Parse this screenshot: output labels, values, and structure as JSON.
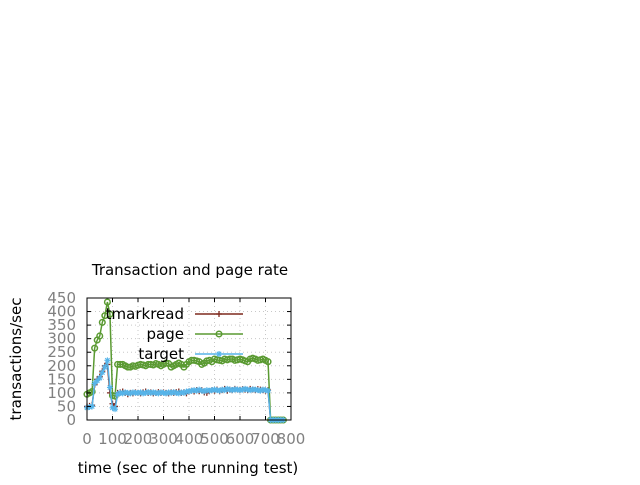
{
  "chart_data": {
    "type": "line",
    "title": "Transaction and page rate",
    "xlabel": "time (sec of the running test)",
    "ylabel": "transactions/sec",
    "xlim": [
      0,
      800
    ],
    "ylim": [
      0,
      450
    ],
    "xticks": [
      0,
      100,
      200,
      300,
      400,
      500,
      600,
      700,
      800
    ],
    "yticks": [
      0,
      50,
      100,
      150,
      200,
      250,
      300,
      350,
      400,
      450
    ],
    "grid": true,
    "legend_position": "top-right",
    "series": [
      {
        "name": "tmarkread",
        "color": "#7f2a1f",
        "marker": "plus",
        "x": [
          0,
          10,
          20,
          30,
          40,
          50,
          60,
          70,
          80,
          90,
          100,
          110,
          120,
          130,
          140,
          150,
          160,
          170,
          180,
          190,
          200,
          210,
          220,
          230,
          240,
          250,
          260,
          270,
          280,
          290,
          300,
          310,
          320,
          330,
          340,
          350,
          360,
          370,
          380,
          390,
          400,
          410,
          420,
          430,
          440,
          450,
          460,
          470,
          480,
          490,
          500,
          510,
          520,
          530,
          540,
          550,
          560,
          570,
          580,
          590,
          600,
          610,
          620,
          630,
          640,
          650,
          660,
          670,
          680,
          690,
          700,
          710,
          720,
          730,
          740,
          750,
          760,
          770
        ],
        "y": [
          50,
          52,
          55,
          130,
          150,
          160,
          180,
          200,
          205,
          100,
          60,
          50,
          100,
          102,
          105,
          100,
          95,
          100,
          98,
          102,
          100,
          98,
          102,
          105,
          100,
          102,
          98,
          100,
          103,
          100,
          102,
          100,
          98,
          102,
          100,
          103,
          105,
          100,
          102,
          98,
          105,
          108,
          105,
          110,
          106,
          110,
          102,
          100,
          106,
          110,
          108,
          112,
          106,
          110,
          115,
          108,
          112,
          110,
          115,
          112,
          110,
          114,
          112,
          110,
          115,
          112,
          110,
          114,
          112,
          110,
          108,
          110,
          0,
          0,
          0,
          0,
          0,
          0
        ]
      },
      {
        "name": "page",
        "color": "#5a9a32",
        "marker": "circle",
        "x": [
          0,
          10,
          20,
          30,
          40,
          50,
          60,
          70,
          80,
          90,
          100,
          110,
          120,
          130,
          140,
          150,
          160,
          170,
          180,
          190,
          200,
          210,
          220,
          230,
          240,
          250,
          260,
          270,
          280,
          290,
          300,
          310,
          320,
          330,
          340,
          350,
          360,
          370,
          380,
          390,
          400,
          410,
          420,
          430,
          440,
          450,
          460,
          470,
          480,
          490,
          500,
          510,
          520,
          530,
          540,
          550,
          560,
          570,
          580,
          590,
          600,
          610,
          620,
          630,
          640,
          650,
          660,
          670,
          680,
          690,
          700,
          710,
          720,
          730,
          740,
          750,
          760,
          770
        ],
        "y": [
          95,
          100,
          105,
          265,
          295,
          310,
          360,
          385,
          435,
          390,
          90,
          88,
          205,
          205,
          205,
          200,
          195,
          195,
          200,
          198,
          202,
          205,
          203,
          200,
          205,
          205,
          203,
          208,
          205,
          200,
          205,
          210,
          208,
          195,
          200,
          205,
          210,
          205,
          195,
          205,
          215,
          220,
          220,
          218,
          215,
          205,
          210,
          218,
          220,
          215,
          225,
          222,
          220,
          218,
          225,
          222,
          225,
          225,
          220,
          222,
          225,
          222,
          218,
          215,
          225,
          228,
          225,
          220,
          222,
          225,
          220,
          215,
          0,
          0,
          0,
          0,
          0,
          0
        ]
      },
      {
        "name": "target",
        "color": "#56b4e9",
        "marker": "star",
        "x": [
          0,
          10,
          20,
          30,
          40,
          50,
          60,
          70,
          80,
          90,
          100,
          110,
          120,
          130,
          140,
          150,
          160,
          170,
          180,
          190,
          200,
          210,
          220,
          230,
          240,
          250,
          260,
          270,
          280,
          290,
          300,
          310,
          320,
          330,
          340,
          350,
          360,
          370,
          380,
          390,
          400,
          410,
          420,
          430,
          440,
          450,
          460,
          470,
          480,
          490,
          500,
          510,
          520,
          530,
          540,
          550,
          560,
          570,
          580,
          590,
          600,
          610,
          620,
          630,
          640,
          650,
          660,
          670,
          680,
          690,
          700,
          710,
          720,
          730,
          740,
          750,
          760,
          770
        ],
        "y": [
          45,
          48,
          50,
          135,
          145,
          155,
          175,
          195,
          220,
          120,
          45,
          40,
          95,
          100,
          98,
          102,
          100,
          98,
          102,
          100,
          100,
          102,
          98,
          100,
          103,
          100,
          102,
          100,
          98,
          102,
          100,
          98,
          102,
          100,
          103,
          100,
          98,
          102,
          100,
          105,
          106,
          108,
          110,
          108,
          112,
          108,
          106,
          110,
          108,
          110,
          112,
          110,
          108,
          112,
          110,
          115,
          112,
          110,
          113,
          112,
          110,
          112,
          115,
          112,
          110,
          113,
          112,
          110,
          108,
          112,
          110,
          108,
          0,
          0,
          0,
          0,
          0,
          0
        ]
      }
    ]
  }
}
